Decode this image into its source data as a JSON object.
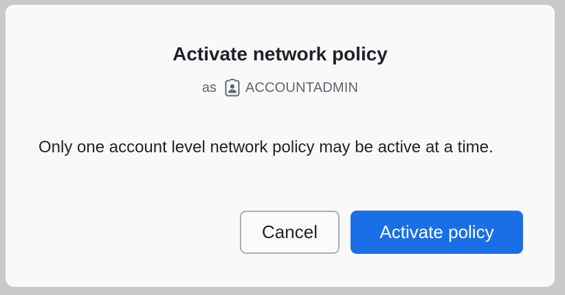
{
  "dialog": {
    "title": "Activate network policy",
    "role_prefix": "as",
    "role_icon": "user-badge-icon",
    "role_name": "ACCOUNTADMIN",
    "message": "Only one account level network policy may be active at a time.",
    "cancel_label": "Cancel",
    "confirm_label": "Activate policy"
  },
  "colors": {
    "primary": "#1a6fe6",
    "text": "#1e2329",
    "muted_text": "#5f6673",
    "dialog_bg": "#f9f9fa",
    "backdrop": "#c9c9cb"
  }
}
